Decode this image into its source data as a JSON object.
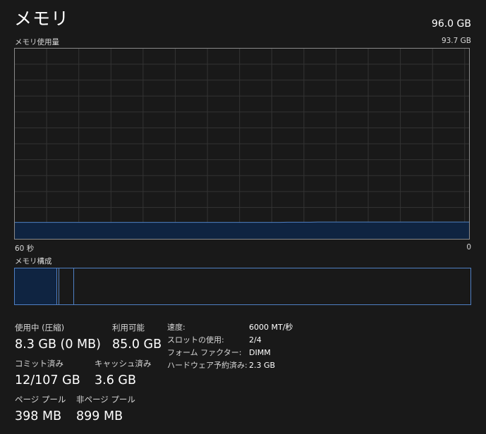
{
  "header": {
    "title": "メモリ",
    "total": "96.0 GB"
  },
  "graph": {
    "label": "メモリ使用量",
    "max_label": "93.7 GB",
    "time_left": "60 秒",
    "time_right": "0",
    "max_gb": 93.7,
    "usage_series_gb": [
      8.1,
      8.1,
      8.1,
      8.1,
      8.1,
      8.1,
      8.1,
      8.1,
      8.1,
      8.1,
      8.1,
      8.1,
      8.1,
      8.1,
      8.1,
      8.1,
      8.1,
      8.1,
      8.1,
      8.1,
      8.1,
      8.1,
      8.1,
      8.1,
      8.1,
      8.1,
      8.1,
      8.1,
      8.1,
      8.1,
      8.1,
      8.1,
      8.1,
      8.1,
      8.1,
      8.1,
      8.2,
      8.2,
      8.2,
      8.2,
      8.3,
      8.3,
      8.3,
      8.3,
      8.3,
      8.3,
      8.3,
      8.3,
      8.3,
      8.3,
      8.3,
      8.3,
      8.3,
      8.3,
      8.3,
      8.3,
      8.3,
      8.3,
      8.3,
      8.3,
      8.3
    ],
    "colors": {
      "line": "#4f80c4",
      "fill": "#0f2441"
    }
  },
  "composition": {
    "label": "メモリ構成"
  },
  "stats": {
    "in_use_label": "使用中 (圧縮)",
    "in_use_value": "8.3 GB (0 MB)",
    "available_label": "利用可能",
    "available_value": "85.0 GB",
    "committed_label": "コミット済み",
    "committed_value": "12/107 GB",
    "cached_label": "キャッシュ済み",
    "cached_value": "3.6 GB",
    "paged_label": "ページ プール",
    "paged_value": "398 MB",
    "nonpaged_label": "非ページ プール",
    "nonpaged_value": "899 MB"
  },
  "info": [
    {
      "key": "速度:",
      "value": "6000 MT/秒"
    },
    {
      "key": "スロットの使用:",
      "value": "2/4"
    },
    {
      "key": "フォーム ファクター:",
      "value": "DIMM"
    },
    {
      "key": "ハードウェア予約済み:",
      "value": "2.3 GB"
    }
  ]
}
